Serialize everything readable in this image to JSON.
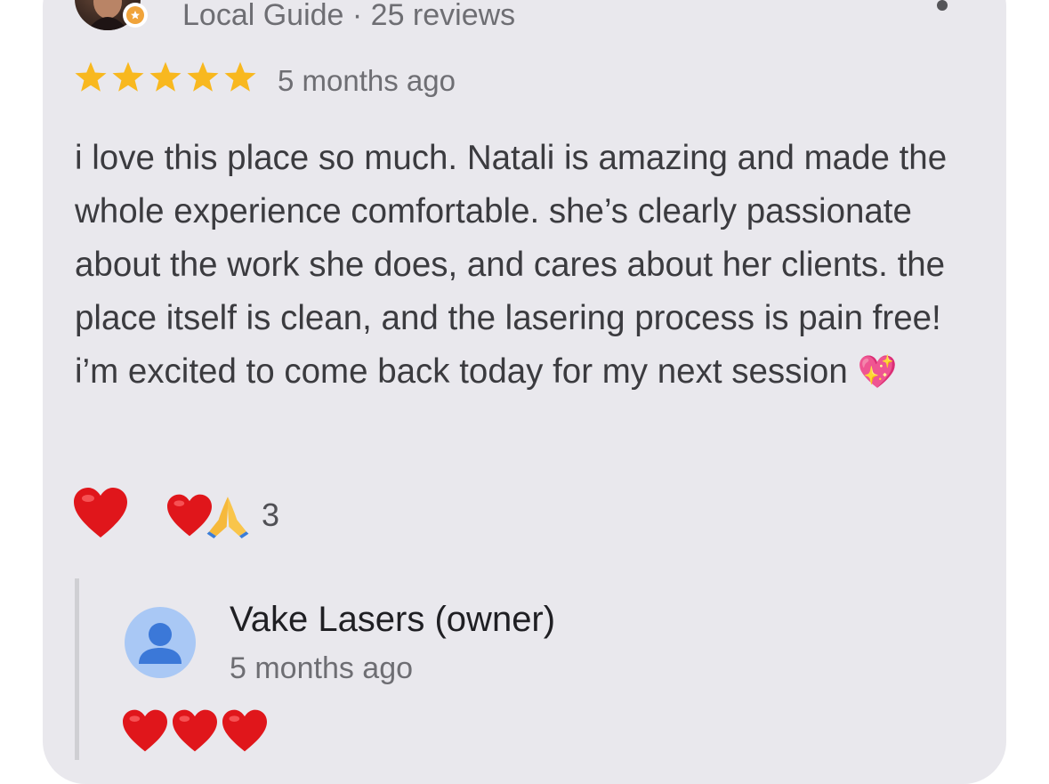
{
  "review": {
    "guide_line": "Local Guide · 25 reviews",
    "rating": 5,
    "rating_max": 5,
    "date": "5 months ago",
    "text": "i love this place so much. Natali is amazing and made the whole experience comfortable. she’s clearly passionate about the work she does, and cares about her clients. the place itself is clean, and the lasering process is pain free! i’m excited to come back today for my next session",
    "text_emoji": "💖",
    "reactions": {
      "count": "3",
      "icons": [
        "heart-icon",
        "praying-hands-icon"
      ]
    }
  },
  "owner_reply": {
    "name": "Vake Lasers (owner)",
    "date": "5 months ago",
    "text_icons": [
      "heart-icon",
      "heart-icon",
      "heart-icon"
    ]
  },
  "colors": {
    "card_bg": "#e9e8ed",
    "star": "#f8b81f",
    "heart": "#e0161b",
    "owner_avatar_bg": "#a9c8f5",
    "owner_avatar_fg": "#3b78d8"
  }
}
